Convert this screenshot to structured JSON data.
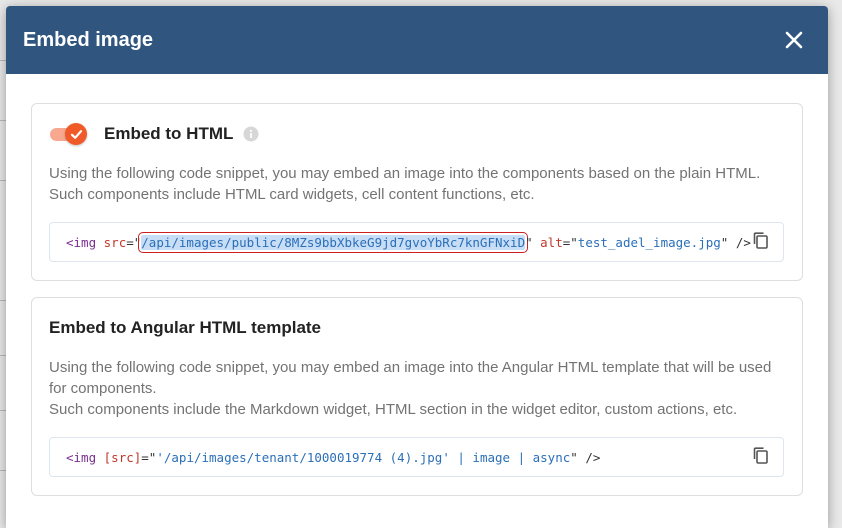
{
  "dialog": {
    "title": "Embed image",
    "close_icon": "close-icon"
  },
  "embed_html": {
    "title": "Embed to HTML",
    "toggle_on": true,
    "description_line1": "Using the following code snippet, you may embed an image into the components based on the plain HTML.",
    "description_line2": "Such components include HTML card widgets, cell content functions, etc.",
    "code": {
      "tag_open": "<img",
      "attr_src": "src",
      "eq_quote": "=\"",
      "src_value": "/api/images/public/8MZs9bbXbkeG9jd7gvoYbRc7knGFNxiD",
      "close_quote": "\"",
      "attr_alt": "alt",
      "eq_quote2": "=\"",
      "alt_value": "test_adel_image.jpg",
      "tag_close": "\" />"
    }
  },
  "embed_angular": {
    "title": "Embed to Angular HTML template",
    "description_line1": "Using the following code snippet, you may embed an image into the Angular HTML template that will be used",
    "description_line2": "for components.",
    "description_line3": "Such components include the Markdown widget, HTML section in the widget editor, custom actions, etc.",
    "code": {
      "tag_open": "<img",
      "attr_src": "[src]",
      "eq_quote": "=\"",
      "src_value": "'/api/images/tenant/1000019774 (4).jpg' | image | async",
      "tag_close": "\" />"
    }
  },
  "colors": {
    "header": "#305680",
    "toggle_accent": "#f05a28"
  }
}
